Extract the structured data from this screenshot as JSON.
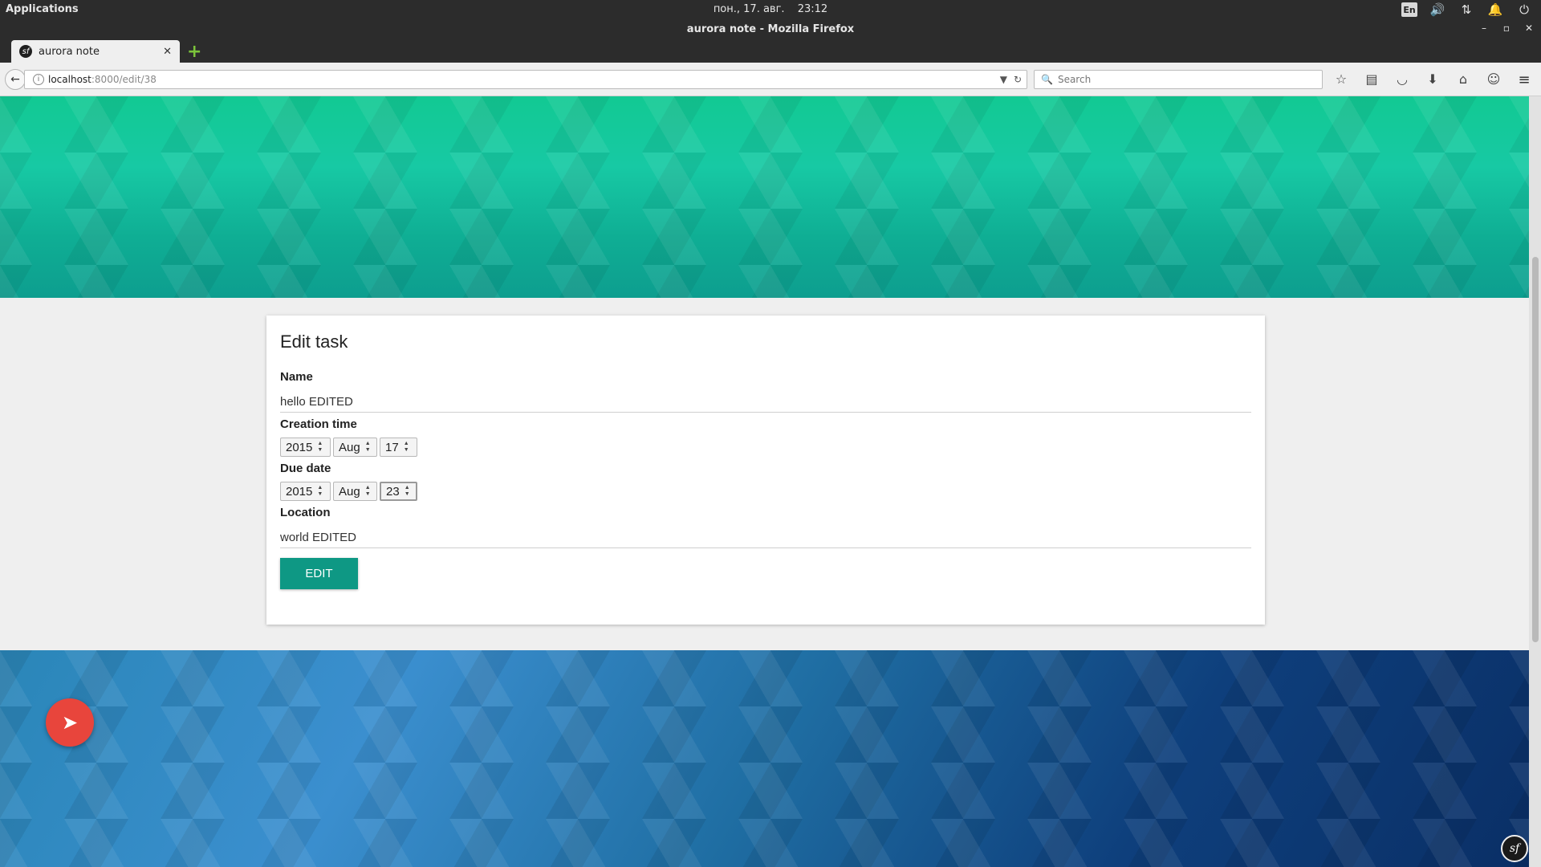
{
  "system": {
    "applications_label": "Applications",
    "date": "пон., 17. авг.",
    "time": "23:12",
    "lang": "En"
  },
  "window": {
    "title": "aurora note - Mozilla Firefox"
  },
  "tab": {
    "label": "aurora note"
  },
  "address": {
    "host": "localhost",
    "path": ":8000/edit/38"
  },
  "search": {
    "placeholder": "Search"
  },
  "form": {
    "heading": "Edit task",
    "name_label": "Name",
    "name_value": "hello EDITED",
    "creation_label": "Creation time",
    "creation": {
      "year": "2015",
      "month": "Aug",
      "day": "17"
    },
    "due_label": "Due date",
    "due": {
      "year": "2015",
      "month": "Aug",
      "day": "23"
    },
    "location_label": "Location",
    "location_value": "world EDITED",
    "submit_label": "EDIT"
  },
  "colors": {
    "accent": "#0e9884",
    "fab": "#e8453c"
  }
}
